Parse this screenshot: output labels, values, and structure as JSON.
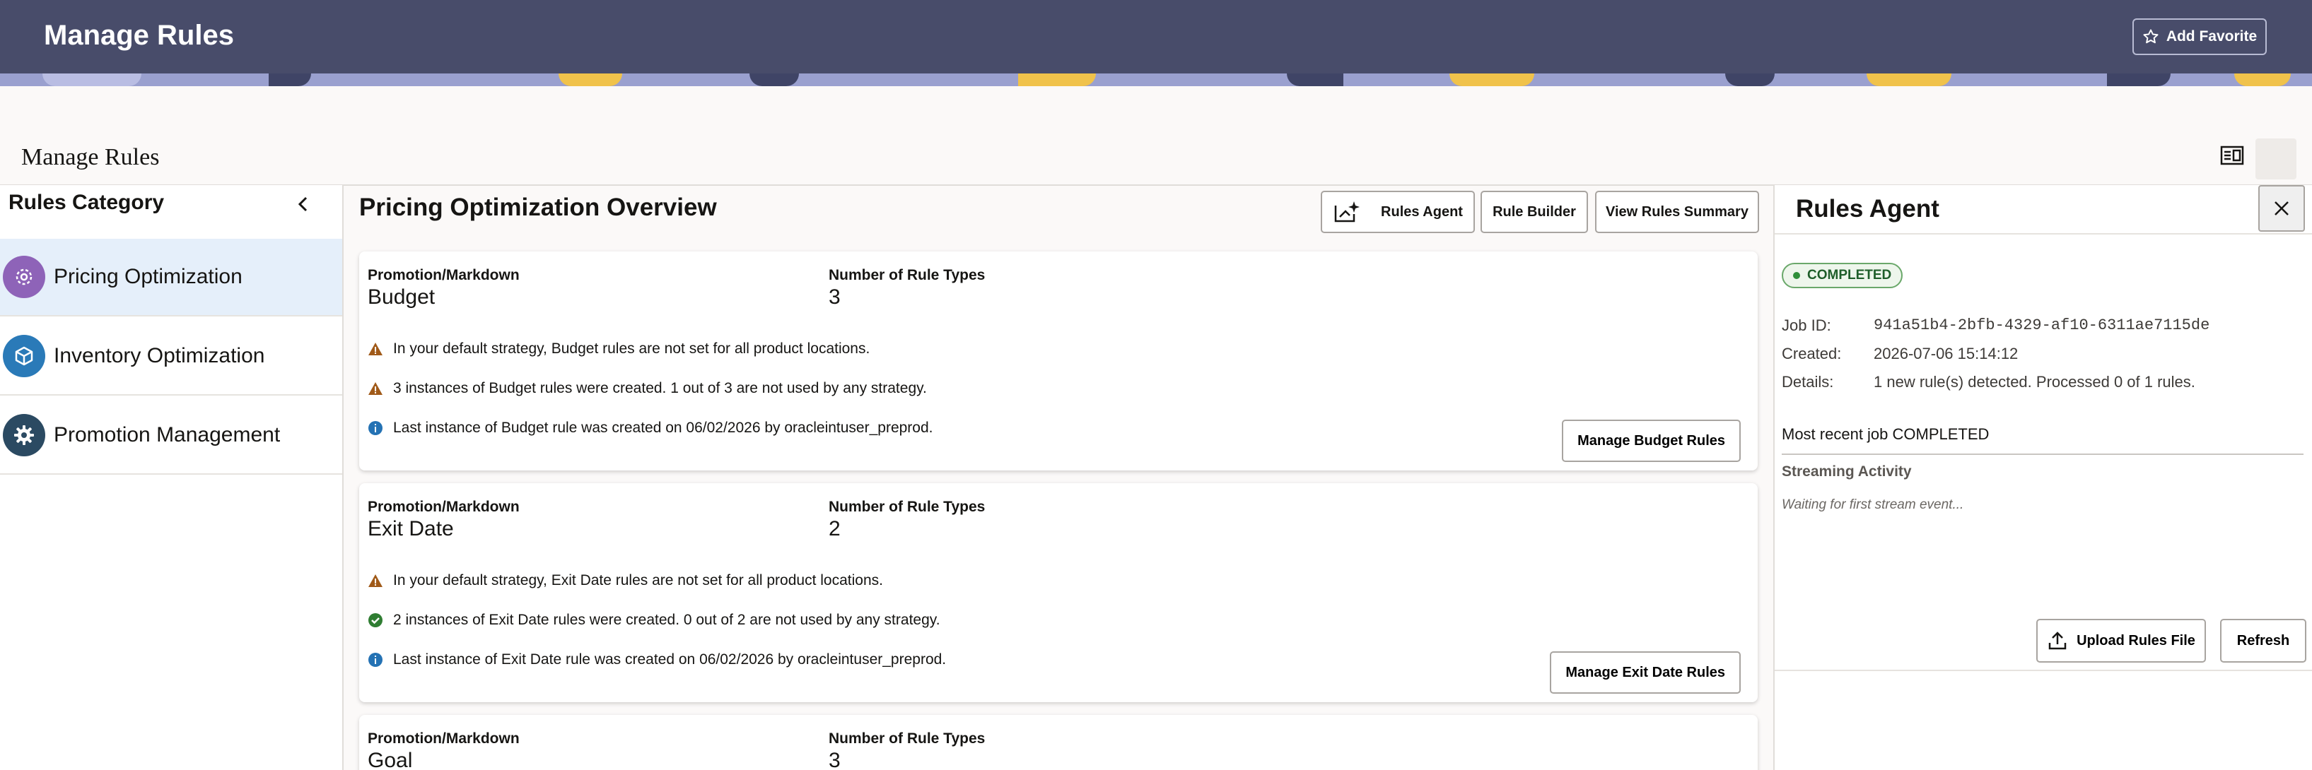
{
  "header": {
    "app_title": "Manage Rules",
    "add_favorite_label": "Add Favorite",
    "colors": {
      "bar": "#484c6a",
      "banner": "#9aa0cf",
      "banner_accent": "#f0c24b"
    }
  },
  "page": {
    "title": "Manage Rules"
  },
  "sidebar": {
    "title": "Rules Category",
    "items": [
      {
        "label": "Pricing Optimization",
        "icon": "gear-cog-icon",
        "color": "#8e63b8",
        "selected": true
      },
      {
        "label": "Inventory Optimization",
        "icon": "cube-icon",
        "color": "#2a7ab8",
        "selected": false
      },
      {
        "label": "Promotion Management",
        "icon": "settings-icon",
        "color": "#2b4a62",
        "selected": false
      }
    ]
  },
  "main": {
    "title": "Pricing Optimization Overview",
    "toolbar": {
      "rules_agent_label": "Rules Agent",
      "rule_builder_label": "Rule Builder",
      "view_summary_label": "View Rules Summary"
    },
    "cards": [
      {
        "category_label": "Promotion/Markdown",
        "name": "Budget",
        "count_label": "Number of Rule Types",
        "count": "3",
        "messages": [
          {
            "type": "warning",
            "text": "In your default strategy, Budget rules are not set for all product locations."
          },
          {
            "type": "warning",
            "text": "3 instances of Budget rules were created. 1 out of 3 are not used by any strategy."
          },
          {
            "type": "info",
            "text": "Last instance of Budget rule was created on 06/02/2026 by oracleintuser_preprod."
          }
        ],
        "action_label": "Manage Budget Rules"
      },
      {
        "category_label": "Promotion/Markdown",
        "name": "Exit Date",
        "count_label": "Number of Rule Types",
        "count": "2",
        "messages": [
          {
            "type": "warning",
            "text": "In your default strategy, Exit Date rules are not set for all product locations."
          },
          {
            "type": "success",
            "text": "2 instances of Exit Date rules were created. 0 out of 2 are not used by any strategy."
          },
          {
            "type": "info",
            "text": "Last instance of Exit Date rule was created on 06/02/2026 by oracleintuser_preprod."
          }
        ],
        "action_label": "Manage Exit Date Rules"
      },
      {
        "category_label": "Promotion/Markdown",
        "name": "Goal",
        "count_label": "Number of Rule Types",
        "count": "3"
      }
    ]
  },
  "agent": {
    "title": "Rules Agent",
    "status": "COMPLETED",
    "job_id_label": "Job ID:",
    "job_id": "941a51b4-2bfb-4329-af10-6311ae7115de",
    "created_label": "Created:",
    "created": "2026-07-06 15:14:12",
    "details_label": "Details:",
    "details": "1 new rule(s) detected. Processed 0 of 1 rules.",
    "recent_job": "Most recent job COMPLETED",
    "streaming_label": "Streaming Activity",
    "streaming_waiting": "Waiting for first stream event...",
    "upload_label": "Upload Rules File",
    "refresh_label": "Refresh"
  }
}
